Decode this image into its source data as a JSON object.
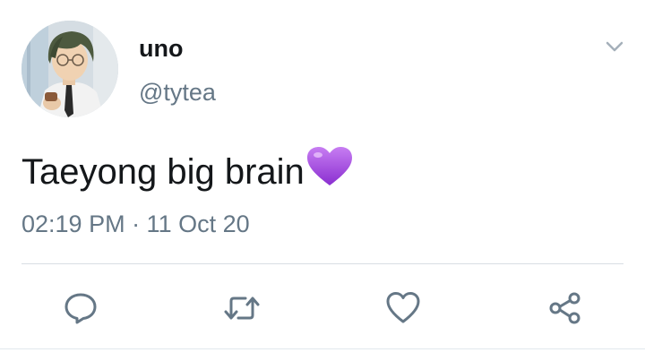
{
  "user": {
    "display_name": "uno",
    "handle": "@tytea"
  },
  "tweet": {
    "text": "Taeyong big brain",
    "emoji": "purple-heart",
    "timestamp": "02:19 PM · 11 Oct 20"
  },
  "actions": {
    "reply_icon": "reply-icon",
    "retweet_icon": "retweet-icon",
    "like_icon": "heart-icon",
    "share_icon": "share-icon"
  },
  "colors": {
    "text": "#14171a",
    "secondary": "#657786",
    "icon": "#657786",
    "emoji_purple": "#a64ee8"
  }
}
